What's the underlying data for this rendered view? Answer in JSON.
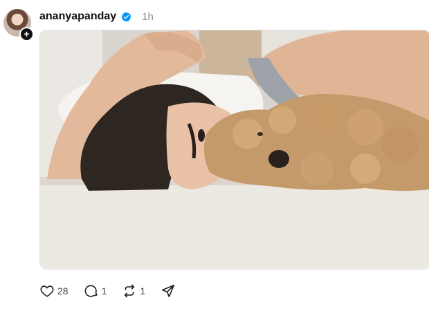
{
  "post": {
    "username": "ananyapanday",
    "time": "1h",
    "verified": true,
    "accent": "#0095f6",
    "image_description_icon": "photo"
  },
  "actions": {
    "likes": "28",
    "replies": "1",
    "reposts": "1",
    "icons": [
      "heart-icon",
      "reply-icon",
      "repost-icon",
      "share-icon"
    ]
  }
}
